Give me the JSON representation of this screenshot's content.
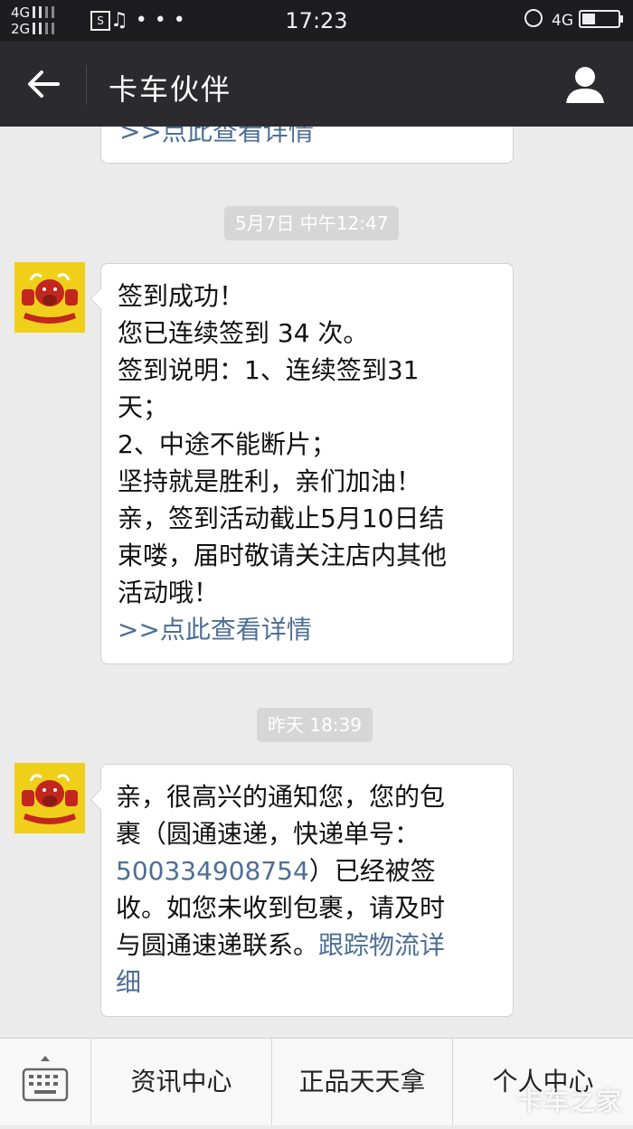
{
  "status_bar": {
    "network_top": "4G",
    "network_bottom": "2G",
    "sim_icon": "S",
    "time": "17:23",
    "network_right": "4G"
  },
  "header": {
    "title": "卡车伙伴"
  },
  "messages": [
    {
      "partial_link": ">>点此查看详情"
    },
    {
      "timestamp": "5月7日 中午12:47",
      "lines": [
        "签到成功！",
        "您已连续签到 34 次。",
        "签到说明：1、连续签到31",
        "天；",
        "2、中途不能断片；",
        "坚持就是胜利，亲们加油！",
        "亲，签到活动截止5月10日结",
        "束喽，届时敬请关注店内其他",
        "活动哦！"
      ],
      "link": ">>点此查看详情"
    },
    {
      "timestamp": "昨天 18:39",
      "line1": "亲，很高兴的通知您，您的包",
      "line2": "裹（圆通速递，快递单号：",
      "tracking_number": "500334908754",
      "line3_rest": "）已经被签",
      "line4": "收。如您未收到包裹，请及时",
      "line5_text": "与圆通速递联系。",
      "line5_link": "跟踪物流详",
      "line6_link": "细"
    }
  ],
  "bottom_menu": {
    "items": [
      "资讯中心",
      "正品天天拿",
      "个人中心"
    ]
  },
  "watermark": "卡车之家",
  "colors": {
    "header_bg": "#2b2b2f",
    "link": "#4d6f94",
    "chat_bg": "#ebebeb",
    "avatar_bg": "#f0cf1a"
  }
}
